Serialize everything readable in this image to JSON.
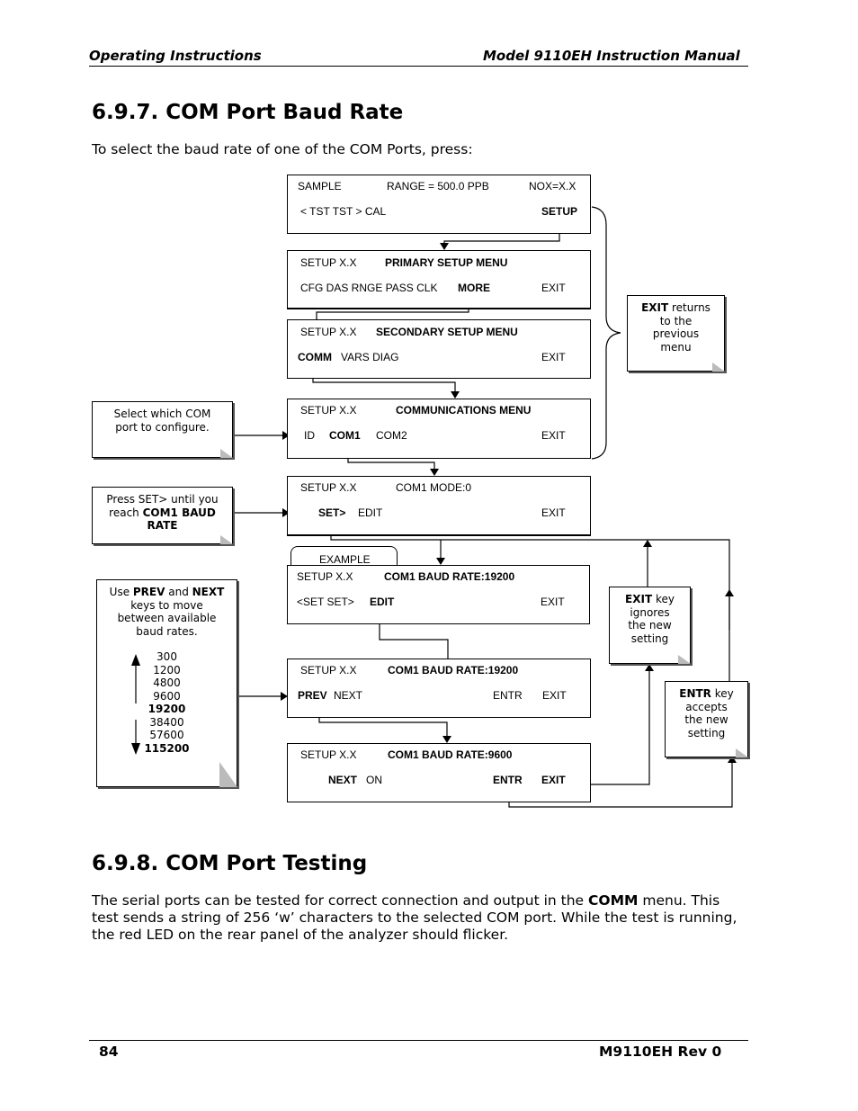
{
  "header": {
    "left": "Operating Instructions",
    "right": "Model 9110EH Instruction Manual"
  },
  "section1": {
    "title": "6.9.7. COM Port Baud Rate",
    "intro": "To select the baud rate of one of the COM Ports, press:"
  },
  "screens": {
    "s1": {
      "a": "SAMPLE",
      "b": "RANGE = 500.0 PPB",
      "c": "NOX=X.X",
      "d": "< TST  TST >  CAL",
      "e": "SETUP"
    },
    "s2": {
      "a": "SETUP X.X",
      "b": "PRIMARY SETUP MENU",
      "c": "CFG  DAS  RNGE  PASS  CLK",
      "d": "MORE",
      "e": "EXIT"
    },
    "s3": {
      "a": "SETUP X.X",
      "b": "SECONDARY SETUP MENU",
      "c": "COMM",
      "d": "VARS   DIAG",
      "e": "EXIT"
    },
    "s4": {
      "a": "SETUP X.X",
      "b": "COMMUNICATIONS MENU",
      "c": "ID",
      "d": "COM1",
      "f": "COM2",
      "e": "EXIT"
    },
    "s5": {
      "a": "SETUP X.X",
      "b": "COM1 MODE:0",
      "c": "SET>",
      "d": "EDIT",
      "e": "EXIT"
    },
    "s6": {
      "tab": "EXAMPLE",
      "a": "SETUP X.X",
      "b": "COM1 BAUD RATE:19200",
      "c": "<SET  SET>",
      "d": "EDIT",
      "e": "EXIT"
    },
    "s7": {
      "a": "SETUP X.X",
      "b": "COM1 BAUD RATE:19200",
      "c": "PREV",
      "d": "NEXT",
      "f": "ENTR",
      "e": "EXIT"
    },
    "s8": {
      "a": "SETUP X.X",
      "b": "COM1 BAUD RATE:9600",
      "c": "NEXT",
      "d": "ON",
      "f": "ENTR",
      "e": "EXIT"
    }
  },
  "notes": {
    "exit_returns": {
      "bold": "EXIT",
      "rest": " returns",
      "l2": "to the",
      "l3": "previous",
      "l4": "menu"
    },
    "select_com": {
      "l1": "Select which COM",
      "l2": "port to configure."
    },
    "press_set": {
      "l1": "Press SET> until you",
      "l2a": "reach ",
      "l2b": "COM1 BAUD",
      "l3": "RATE"
    },
    "use_prev": {
      "a": "Use ",
      "b": "PREV",
      "c": " and ",
      "d": "NEXT",
      "l2": "keys to move",
      "l3": "between available",
      "l4": "baud rates.",
      "rates": [
        "300",
        "1200",
        "4800",
        "9600",
        "19200",
        "38400",
        "57600",
        "115200"
      ]
    },
    "exit_key": {
      "bold": "EXIT",
      "rest": " key",
      "l2": "ignores",
      "l3": "the new",
      "l4": "setting"
    },
    "entr_key": {
      "bold": "ENTR",
      "rest": " key",
      "l2": "accepts",
      "l3": "the new",
      "l4": "setting"
    }
  },
  "section2": {
    "title": "6.9.8. COM Port Testing",
    "p1a": "The serial ports can be tested for correct connection and output in the ",
    "p1b": "COMM",
    "p1c": " menu. This",
    "p2": "test sends a string of 256 ‘w’ characters to the selected COM port. While the test is running,",
    "p3": "the red LED on the rear panel of the analyzer should flicker."
  },
  "footer": {
    "page": "84",
    "rev": "M9110EH Rev 0"
  }
}
